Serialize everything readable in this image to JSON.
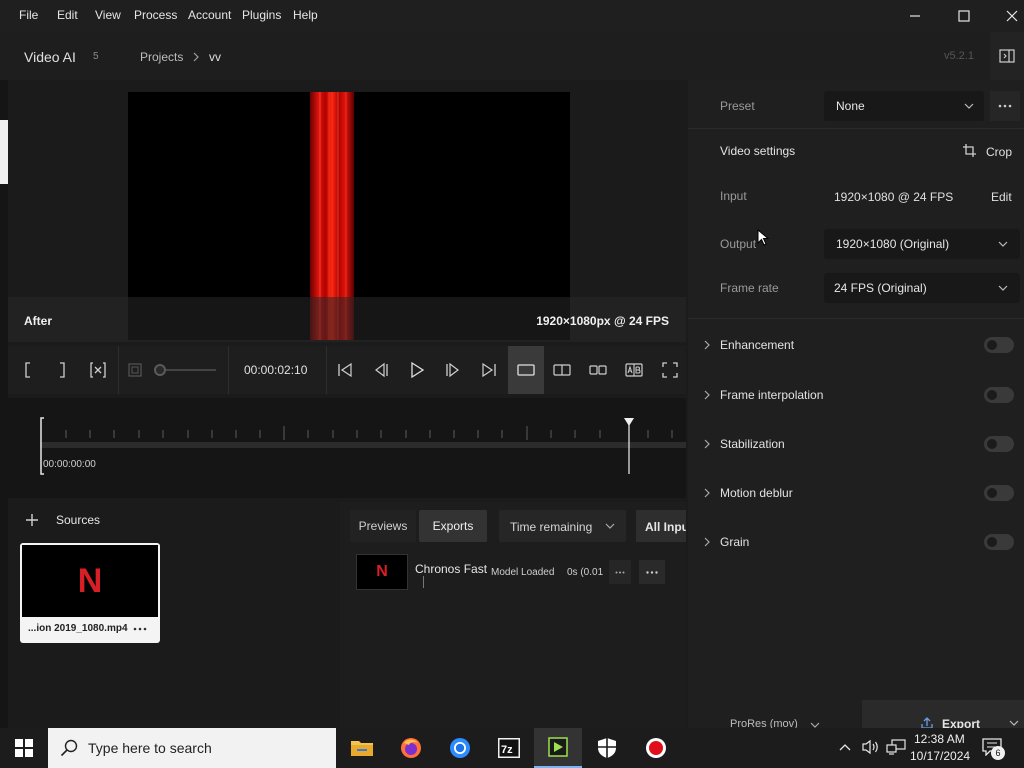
{
  "menubar": {
    "items": [
      "File",
      "Edit",
      "View",
      "Process",
      "Account",
      "Plugins",
      "Help"
    ]
  },
  "header": {
    "app_name": "Video AI",
    "app_version_badge": "5",
    "breadcrumb_projects": "Projects",
    "breadcrumb_current": "vv",
    "version": "v5.2.1"
  },
  "preview": {
    "after_label": "After",
    "resolution_label": "1920×1080px @ 24 FPS"
  },
  "controls": {
    "timecode": "00:00:02:10"
  },
  "timeline": {
    "start_time": "00:00:00:00"
  },
  "sources": {
    "title": "Sources",
    "file_name": "...ion 2019_1080.mp4",
    "thumb_letter": "N"
  },
  "exports": {
    "tab_previews": "Previews",
    "tab_exports": "Exports",
    "sort_select": "Time remaining",
    "filter_button": "All Inpu",
    "item_name": "Chronos Fast",
    "item_status": "Model Loaded",
    "item_time": "0s (0.01",
    "thumb_letter": "N"
  },
  "right_panel": {
    "preset_label": "Preset",
    "preset_value": "None",
    "video_settings_title": "Video settings",
    "crop_label": "Crop",
    "input_label": "Input",
    "input_value": "1920×1080 @ 24 FPS",
    "edit_label": "Edit",
    "output_label": "Output",
    "output_value": "1920×1080 (Original)",
    "frame_rate_label": "Frame rate",
    "frame_rate_value": "24 FPS (Original)",
    "sections": [
      {
        "label": "Enhancement",
        "enabled": false
      },
      {
        "label": "Frame interpolation",
        "enabled": false
      },
      {
        "label": "Stabilization",
        "enabled": false
      },
      {
        "label": "Motion deblur",
        "enabled": false
      },
      {
        "label": "Grain",
        "enabled": false
      }
    ],
    "codec_label": "ProRes (mov)",
    "export_button": "Export"
  },
  "taskbar": {
    "search_placeholder": "Type here to search",
    "time": "12:38 AM",
    "date": "10/17/2024",
    "notification_count": "6"
  },
  "colors": {
    "accent_red": "#e50914",
    "netflix_red": "#d81f26"
  }
}
